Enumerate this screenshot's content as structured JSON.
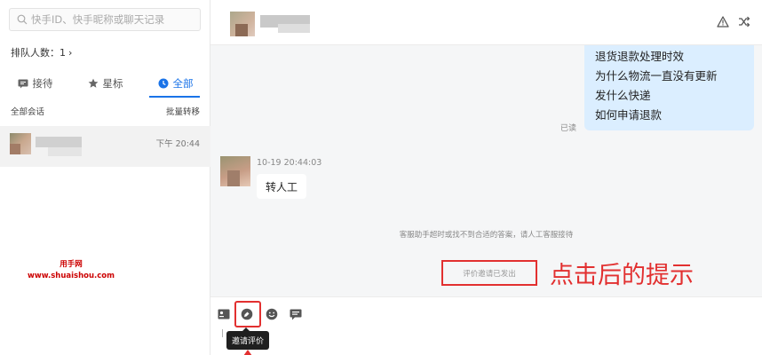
{
  "search": {
    "placeholder": "快手ID、快手昵称或聊天记录"
  },
  "queue": {
    "label": "排队人数：1"
  },
  "tabs": [
    {
      "label": "接待",
      "icon": "message-icon"
    },
    {
      "label": "星标",
      "icon": "star-icon"
    },
    {
      "label": "全部",
      "icon": "clock-icon"
    }
  ],
  "list": {
    "header_left": "全部会话",
    "header_right": "批量转移",
    "items": [
      {
        "time": "下午 20:44"
      }
    ]
  },
  "watermark": {
    "line1": "用手网",
    "line2": "www.shuaishou.com"
  },
  "chat": {
    "outgoing_lines": [
      "退货退款处理时效",
      "为什么物流一直没有更新",
      "发什么快递",
      "如何申请退款"
    ],
    "read_status": "已读",
    "incoming_time": "10-19 20:44:03",
    "incoming_text": "转人工",
    "system_note": "客服助手超时或找不到合适的答案，请人工客服接待",
    "evaluation_sent": "评价邀请已发出"
  },
  "annotation": {
    "text": "点击后的提示"
  },
  "composer": {
    "tooltip": "邀请评价",
    "tools": [
      "quick-reply-icon",
      "invite-evaluation-icon",
      "emoji-icon",
      "comment-icon"
    ]
  },
  "colors": {
    "accent": "#1a73e8",
    "annotation_red": "#e23030",
    "outgoing_bubble": "#dbeeff"
  }
}
